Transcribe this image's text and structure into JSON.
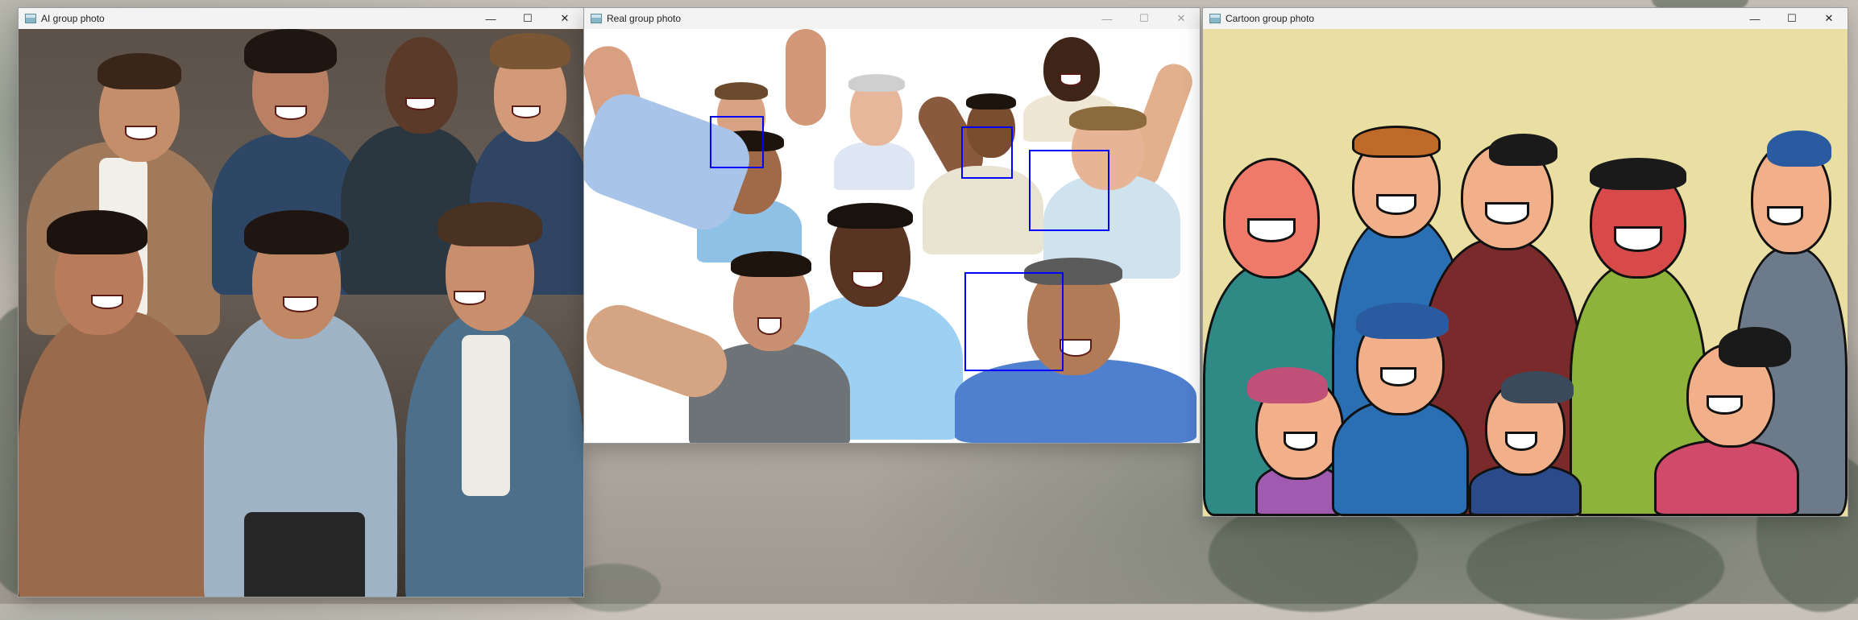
{
  "windows": [
    {
      "id": "ai",
      "title": "AI group photo",
      "controls": {
        "minimize": "—",
        "maximize": "☐",
        "close": "✕"
      }
    },
    {
      "id": "real",
      "title": "Real group photo",
      "controls": {
        "minimize": "—",
        "maximize": "☐",
        "close": "✕"
      }
    },
    {
      "id": "cartoon",
      "title": "Cartoon group photo",
      "controls": {
        "minimize": "—",
        "maximize": "☐",
        "close": "✕"
      }
    }
  ],
  "colors": {
    "face_box": "#0000ff",
    "cartoon_bg": "#eadfa3",
    "titlebar": "#f3f3f3"
  },
  "real_photo": {
    "detected_faces": 4
  }
}
